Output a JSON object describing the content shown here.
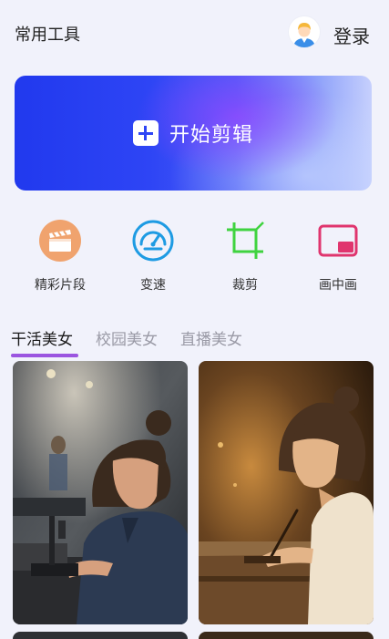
{
  "header": {
    "title": "常用工具",
    "login_label": "登录"
  },
  "hero": {
    "label": "开始剪辑"
  },
  "tools": [
    {
      "label": "精彩片段",
      "icon": "clapperboard-icon",
      "color": "#f0a36e"
    },
    {
      "label": "变速",
      "icon": "speedometer-icon",
      "color": "#1e9be3"
    },
    {
      "label": "裁剪",
      "icon": "crop-icon",
      "color": "#3fd33f"
    },
    {
      "label": "画中画",
      "icon": "picture-in-picture-icon",
      "color": "#e0356e"
    }
  ],
  "tabs": [
    {
      "label": "干活美女",
      "active": true
    },
    {
      "label": "校园美女",
      "active": false
    },
    {
      "label": "直播美女",
      "active": false
    }
  ],
  "colors": {
    "accent": "#9b55e0",
    "hero_blue": "#2e45f5",
    "background": "#f1f2fb"
  }
}
